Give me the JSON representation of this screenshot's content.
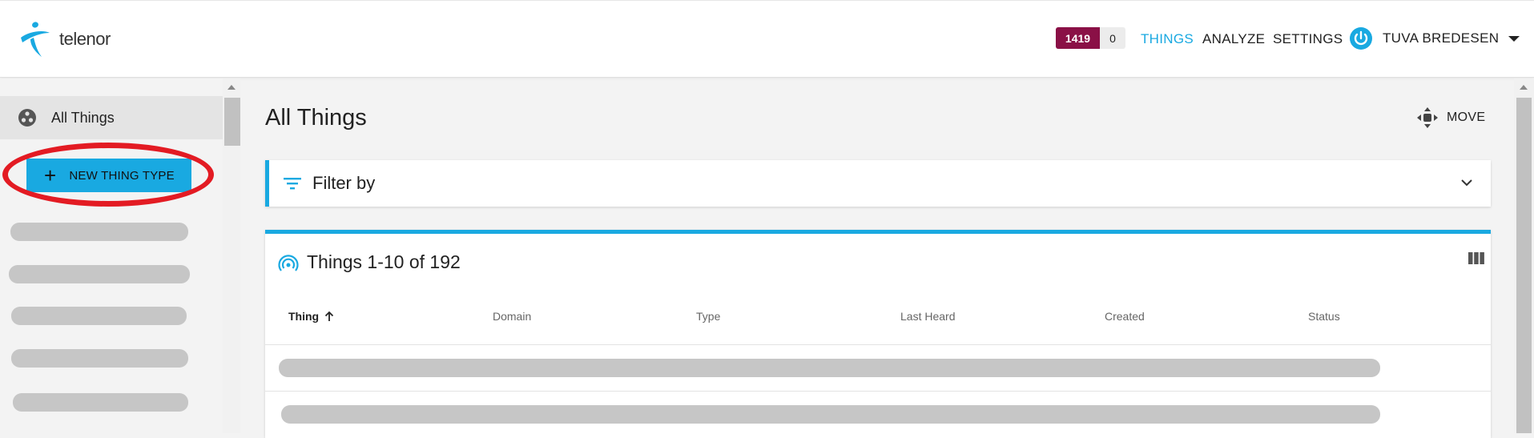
{
  "header": {
    "logo_text": "telenor",
    "badge_count_a": "1419",
    "badge_count_b": "0",
    "nav": [
      "THINGS",
      "ANALYZE",
      "SETTINGS"
    ],
    "user_name": "TUVA BREDESEN"
  },
  "sidebar": {
    "all_things_label": "All Things",
    "new_thing_type_label": "NEW THING TYPE"
  },
  "main": {
    "page_title": "All Things",
    "move_label": "MOVE",
    "filter_label": "Filter by",
    "things_title": "Things 1-10 of 192",
    "columns": [
      "Thing",
      "Domain",
      "Type",
      "Last Heard",
      "Created",
      "Status"
    ]
  },
  "colors": {
    "accent": "#19a9e1",
    "badge": "#8a1046",
    "annotation": "#e31b23"
  }
}
